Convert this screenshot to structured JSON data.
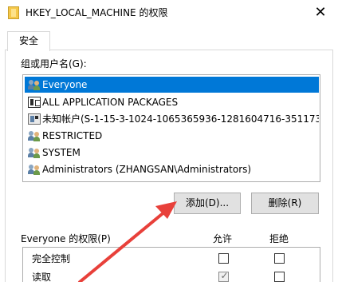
{
  "window": {
    "title": "HKEY_LOCAL_MACHINE 的权限",
    "close_glyph": "✕"
  },
  "tabs": [
    {
      "label": "安全",
      "active": true
    }
  ],
  "groups": {
    "label": "组或用户名(G):",
    "items": [
      {
        "name": "Everyone",
        "icon": "users-icon",
        "selected": true
      },
      {
        "name": "ALL APPLICATION PACKAGES",
        "icon": "package-icon",
        "selected": false
      },
      {
        "name": "未知帐户(S-1-15-3-1024-1065365936-1281604716-351173...",
        "icon": "unknown-account-icon",
        "selected": false
      },
      {
        "name": "RESTRICTED",
        "icon": "users-icon",
        "selected": false
      },
      {
        "name": "SYSTEM",
        "icon": "users-icon",
        "selected": false
      },
      {
        "name": "Administrators (ZHANGSAN\\Administrators)",
        "icon": "users-icon",
        "selected": false
      }
    ]
  },
  "buttons": {
    "add_label": "添加(D)...",
    "remove_label": "删除(R)"
  },
  "permissions": {
    "title": "Everyone 的权限(P)",
    "allow_header": "允许",
    "deny_header": "拒绝",
    "rows": [
      {
        "name": "完全控制",
        "allow": false,
        "deny": false
      },
      {
        "name": "读取",
        "allow": true,
        "deny": false
      }
    ]
  },
  "colors": {
    "selection": "#0078d7",
    "annotation_arrow": "#e8403a"
  }
}
